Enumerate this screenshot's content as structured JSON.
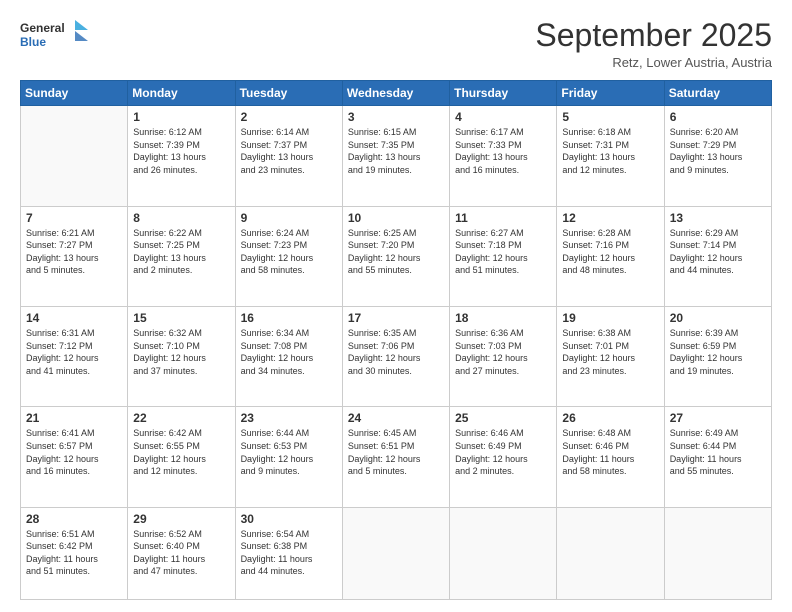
{
  "logo": {
    "line1": "General",
    "line2": "Blue"
  },
  "header": {
    "month": "September 2025",
    "location": "Retz, Lower Austria, Austria"
  },
  "weekdays": [
    "Sunday",
    "Monday",
    "Tuesday",
    "Wednesday",
    "Thursday",
    "Friday",
    "Saturday"
  ],
  "weeks": [
    [
      {
        "day": "",
        "text": ""
      },
      {
        "day": "1",
        "text": "Sunrise: 6:12 AM\nSunset: 7:39 PM\nDaylight: 13 hours\nand 26 minutes."
      },
      {
        "day": "2",
        "text": "Sunrise: 6:14 AM\nSunset: 7:37 PM\nDaylight: 13 hours\nand 23 minutes."
      },
      {
        "day": "3",
        "text": "Sunrise: 6:15 AM\nSunset: 7:35 PM\nDaylight: 13 hours\nand 19 minutes."
      },
      {
        "day": "4",
        "text": "Sunrise: 6:17 AM\nSunset: 7:33 PM\nDaylight: 13 hours\nand 16 minutes."
      },
      {
        "day": "5",
        "text": "Sunrise: 6:18 AM\nSunset: 7:31 PM\nDaylight: 13 hours\nand 12 minutes."
      },
      {
        "day": "6",
        "text": "Sunrise: 6:20 AM\nSunset: 7:29 PM\nDaylight: 13 hours\nand 9 minutes."
      }
    ],
    [
      {
        "day": "7",
        "text": "Sunrise: 6:21 AM\nSunset: 7:27 PM\nDaylight: 13 hours\nand 5 minutes."
      },
      {
        "day": "8",
        "text": "Sunrise: 6:22 AM\nSunset: 7:25 PM\nDaylight: 13 hours\nand 2 minutes."
      },
      {
        "day": "9",
        "text": "Sunrise: 6:24 AM\nSunset: 7:23 PM\nDaylight: 12 hours\nand 58 minutes."
      },
      {
        "day": "10",
        "text": "Sunrise: 6:25 AM\nSunset: 7:20 PM\nDaylight: 12 hours\nand 55 minutes."
      },
      {
        "day": "11",
        "text": "Sunrise: 6:27 AM\nSunset: 7:18 PM\nDaylight: 12 hours\nand 51 minutes."
      },
      {
        "day": "12",
        "text": "Sunrise: 6:28 AM\nSunset: 7:16 PM\nDaylight: 12 hours\nand 48 minutes."
      },
      {
        "day": "13",
        "text": "Sunrise: 6:29 AM\nSunset: 7:14 PM\nDaylight: 12 hours\nand 44 minutes."
      }
    ],
    [
      {
        "day": "14",
        "text": "Sunrise: 6:31 AM\nSunset: 7:12 PM\nDaylight: 12 hours\nand 41 minutes."
      },
      {
        "day": "15",
        "text": "Sunrise: 6:32 AM\nSunset: 7:10 PM\nDaylight: 12 hours\nand 37 minutes."
      },
      {
        "day": "16",
        "text": "Sunrise: 6:34 AM\nSunset: 7:08 PM\nDaylight: 12 hours\nand 34 minutes."
      },
      {
        "day": "17",
        "text": "Sunrise: 6:35 AM\nSunset: 7:06 PM\nDaylight: 12 hours\nand 30 minutes."
      },
      {
        "day": "18",
        "text": "Sunrise: 6:36 AM\nSunset: 7:03 PM\nDaylight: 12 hours\nand 27 minutes."
      },
      {
        "day": "19",
        "text": "Sunrise: 6:38 AM\nSunset: 7:01 PM\nDaylight: 12 hours\nand 23 minutes."
      },
      {
        "day": "20",
        "text": "Sunrise: 6:39 AM\nSunset: 6:59 PM\nDaylight: 12 hours\nand 19 minutes."
      }
    ],
    [
      {
        "day": "21",
        "text": "Sunrise: 6:41 AM\nSunset: 6:57 PM\nDaylight: 12 hours\nand 16 minutes."
      },
      {
        "day": "22",
        "text": "Sunrise: 6:42 AM\nSunset: 6:55 PM\nDaylight: 12 hours\nand 12 minutes."
      },
      {
        "day": "23",
        "text": "Sunrise: 6:44 AM\nSunset: 6:53 PM\nDaylight: 12 hours\nand 9 minutes."
      },
      {
        "day": "24",
        "text": "Sunrise: 6:45 AM\nSunset: 6:51 PM\nDaylight: 12 hours\nand 5 minutes."
      },
      {
        "day": "25",
        "text": "Sunrise: 6:46 AM\nSunset: 6:49 PM\nDaylight: 12 hours\nand 2 minutes."
      },
      {
        "day": "26",
        "text": "Sunrise: 6:48 AM\nSunset: 6:46 PM\nDaylight: 11 hours\nand 58 minutes."
      },
      {
        "day": "27",
        "text": "Sunrise: 6:49 AM\nSunset: 6:44 PM\nDaylight: 11 hours\nand 55 minutes."
      }
    ],
    [
      {
        "day": "28",
        "text": "Sunrise: 6:51 AM\nSunset: 6:42 PM\nDaylight: 11 hours\nand 51 minutes."
      },
      {
        "day": "29",
        "text": "Sunrise: 6:52 AM\nSunset: 6:40 PM\nDaylight: 11 hours\nand 47 minutes."
      },
      {
        "day": "30",
        "text": "Sunrise: 6:54 AM\nSunset: 6:38 PM\nDaylight: 11 hours\nand 44 minutes."
      },
      {
        "day": "",
        "text": ""
      },
      {
        "day": "",
        "text": ""
      },
      {
        "day": "",
        "text": ""
      },
      {
        "day": "",
        "text": ""
      }
    ]
  ]
}
